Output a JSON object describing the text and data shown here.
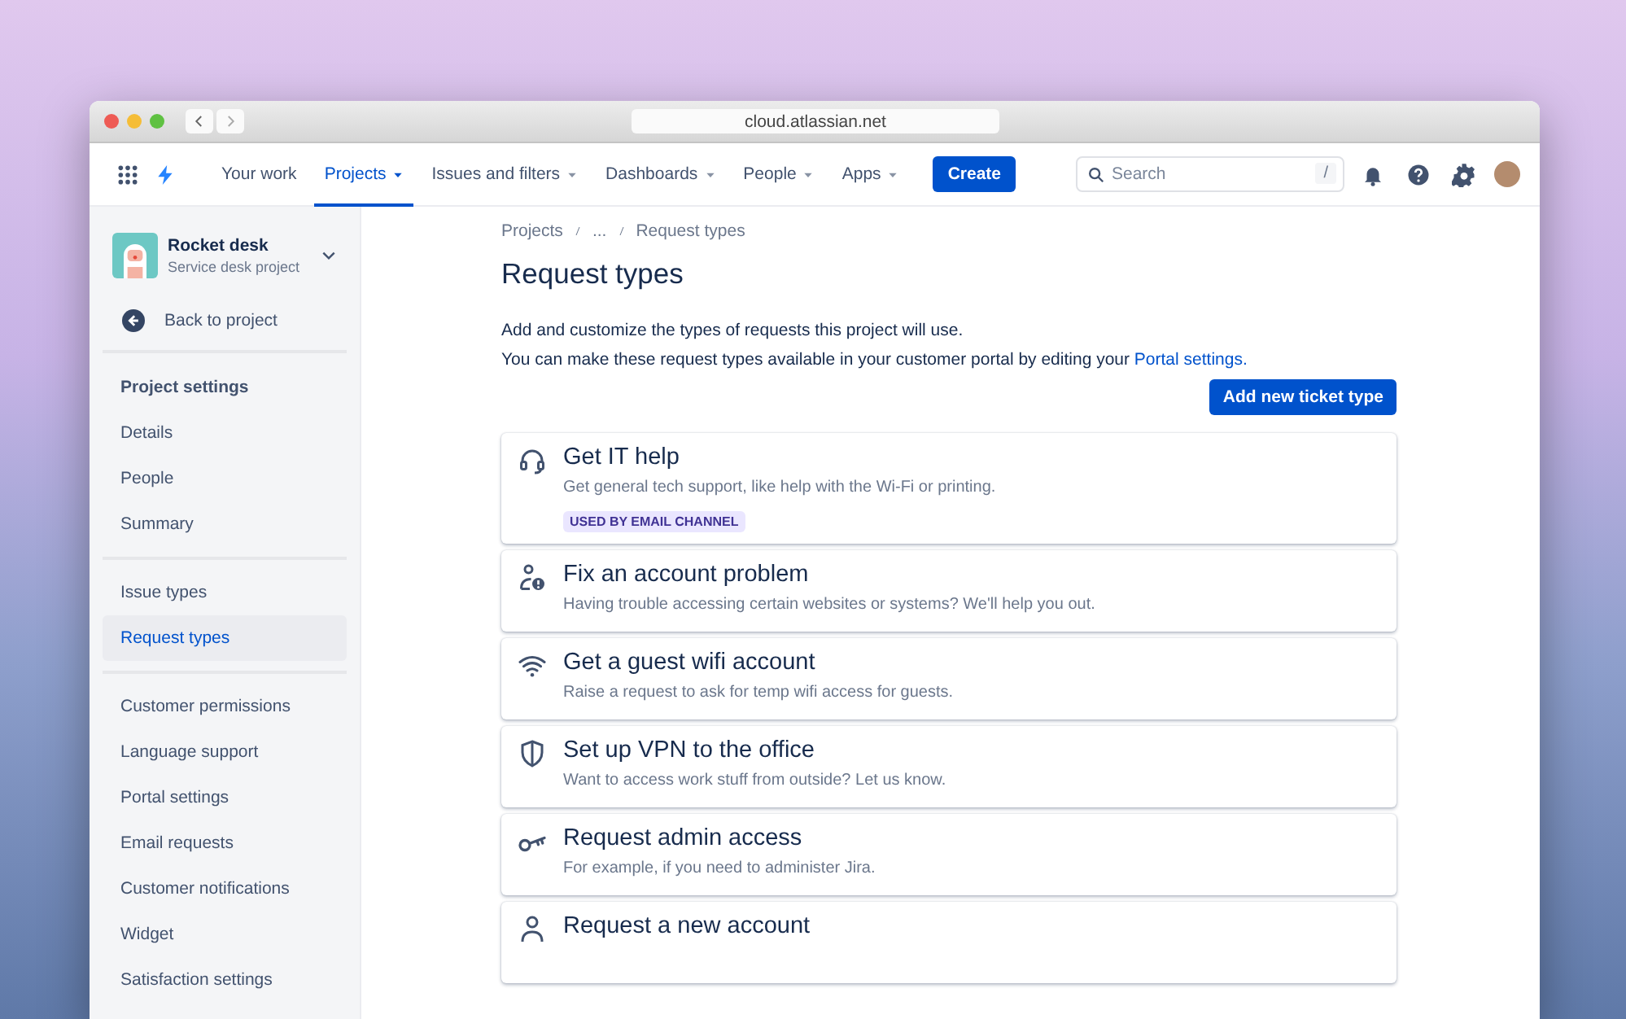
{
  "browser": {
    "url": "cloud.atlassian.net"
  },
  "nav": {
    "items": [
      {
        "label": "Your work",
        "selected": false,
        "has_menu": false
      },
      {
        "label": "Projects",
        "selected": true,
        "has_menu": true
      },
      {
        "label": "Issues and filters",
        "selected": false,
        "has_menu": true
      },
      {
        "label": "Dashboards",
        "selected": false,
        "has_menu": true
      },
      {
        "label": "People",
        "selected": false,
        "has_menu": true
      },
      {
        "label": "Apps",
        "selected": false,
        "has_menu": true
      }
    ],
    "create_button": "Create",
    "search": {
      "placeholder": "Search",
      "shortcut": "/"
    }
  },
  "sidebar": {
    "project": {
      "name": "Rocket desk",
      "type": "Service desk project"
    },
    "back_link": "Back to project",
    "heading": "Project settings",
    "groups": [
      [
        {
          "label": "Details",
          "selected": false
        },
        {
          "label": "People",
          "selected": false
        },
        {
          "label": "Summary",
          "selected": false
        }
      ],
      [
        {
          "label": "Issue types",
          "selected": false
        },
        {
          "label": "Request types",
          "selected": true
        }
      ],
      [
        {
          "label": "Customer permissions",
          "selected": false
        },
        {
          "label": "Language support",
          "selected": false
        },
        {
          "label": "Portal settings",
          "selected": false
        },
        {
          "label": "Email requests",
          "selected": false
        },
        {
          "label": "Customer notifications",
          "selected": false
        },
        {
          "label": "Widget",
          "selected": false
        },
        {
          "label": "Satisfaction settings",
          "selected": false
        }
      ]
    ]
  },
  "content": {
    "breadcrumbs": [
      "Projects",
      "...",
      "Request types"
    ],
    "title": "Request types",
    "intro": "Add and customize the types of requests this project will use.",
    "portal_text": "You can make these request types available in your customer portal by editing your",
    "portal_link": "Portal settings.",
    "add_button": "Add new ticket type",
    "request_types": [
      {
        "kind": "headset",
        "title": "Get IT help",
        "description": "Get general tech support, like help with the Wi-Fi or printing.",
        "badge": "USED BY EMAIL CHANNEL"
      },
      {
        "kind": "person-alert",
        "title": "Fix an account problem",
        "description": "Having trouble accessing certain websites or systems? We'll help you out."
      },
      {
        "kind": "wifi",
        "title": "Get a guest wifi account",
        "description": "Raise a request to ask for temp wifi access for guests."
      },
      {
        "kind": "shield",
        "title": "Set up VPN to the office",
        "description": "Want to access work stuff from outside? Let us know."
      },
      {
        "kind": "key",
        "title": "Request admin access",
        "description": "For example, if you need to administer Jira."
      },
      {
        "kind": "person",
        "title": "Request a new account"
      }
    ]
  }
}
